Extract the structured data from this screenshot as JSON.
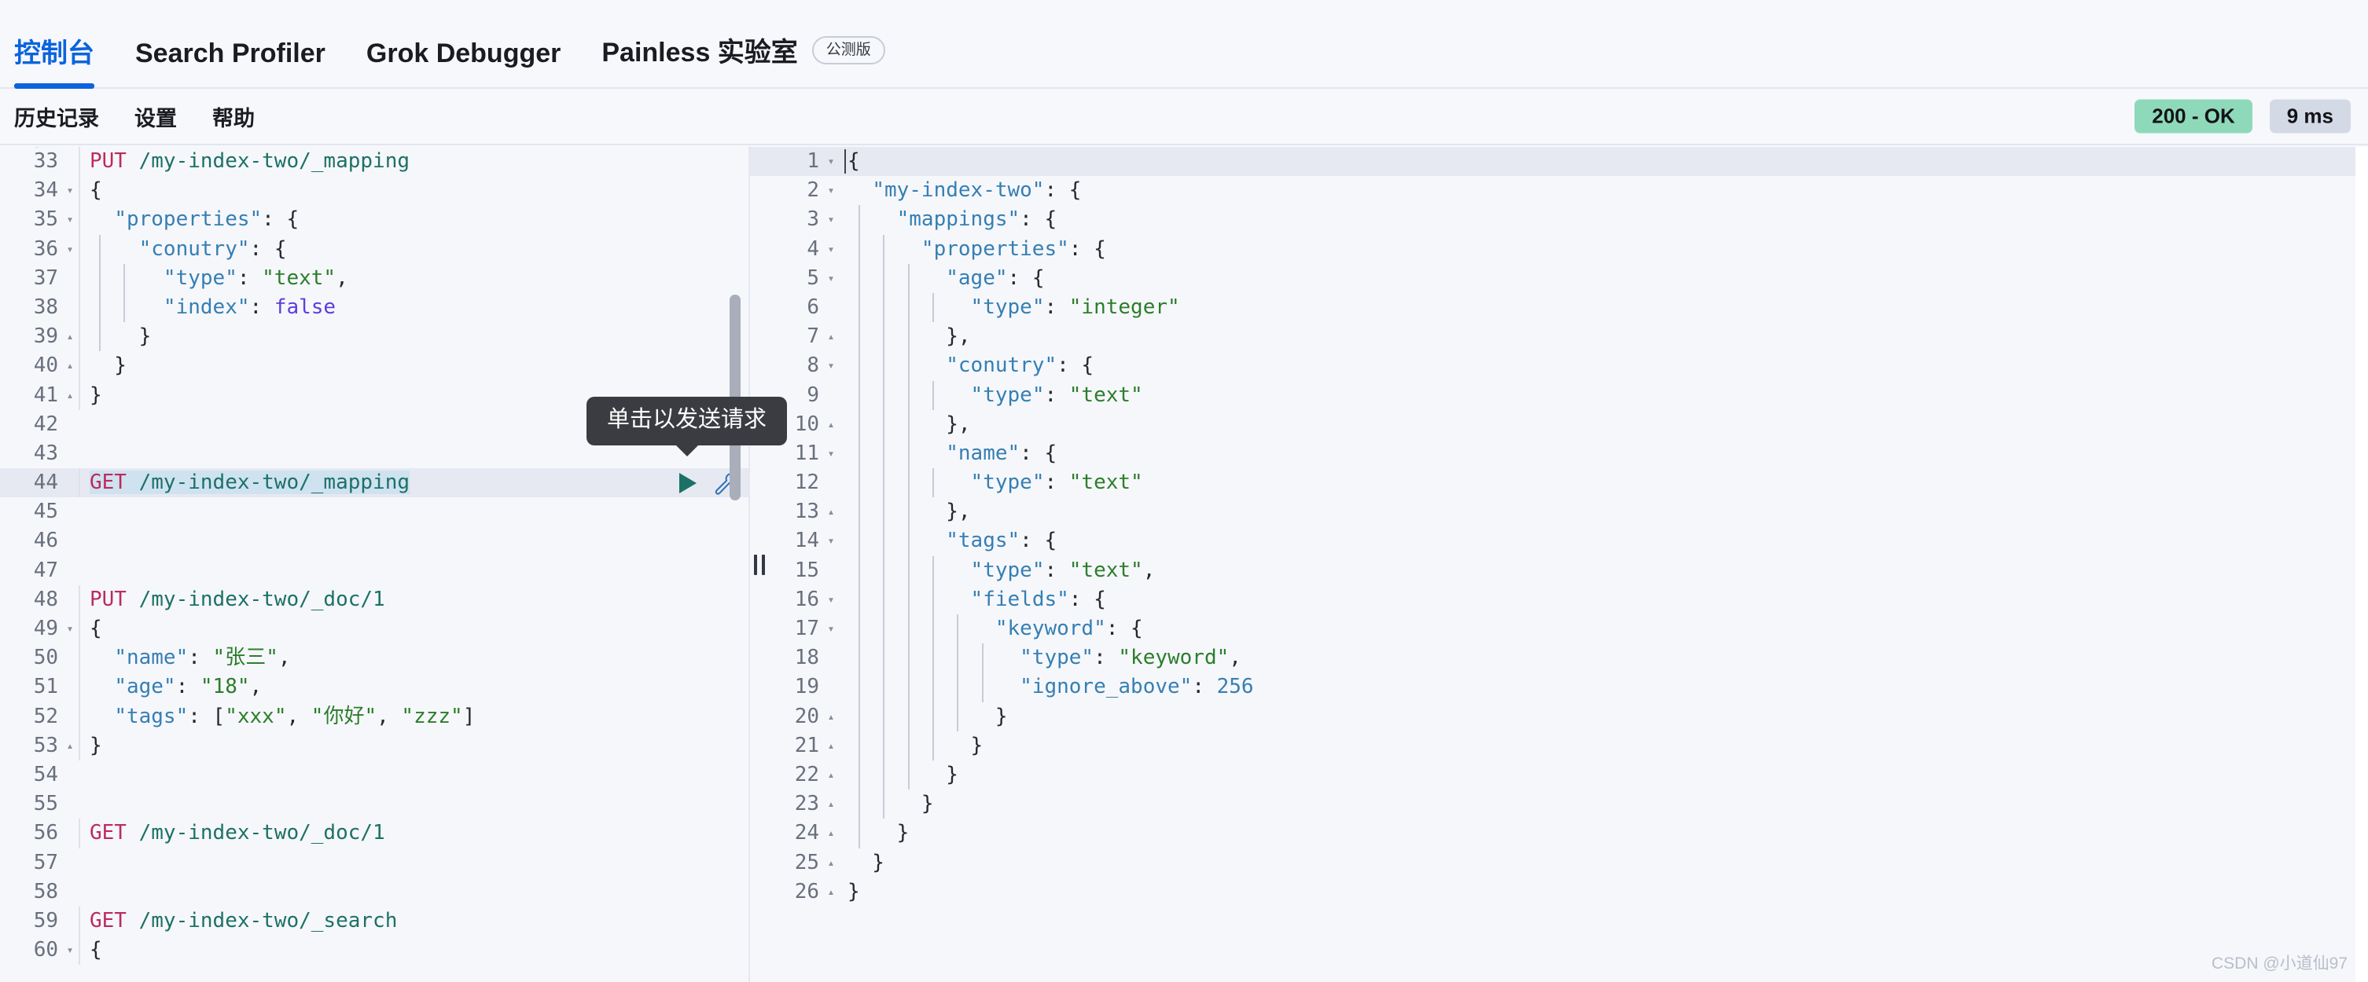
{
  "header": {
    "tabs": [
      {
        "label": "控制台",
        "active": true
      },
      {
        "label": "Search Profiler",
        "active": false
      },
      {
        "label": "Grok Debugger",
        "active": false
      },
      {
        "label": "Painless 实验室",
        "active": false,
        "badge": "公测版"
      }
    ]
  },
  "subnav": {
    "items": [
      {
        "label": "历史记录"
      },
      {
        "label": "设置"
      },
      {
        "label": "帮助"
      }
    ],
    "status_code": "200 - OK",
    "duration": "9 ms"
  },
  "tooltip": {
    "text": "单击以发送请求"
  },
  "request_editor": {
    "first_visible_line": 33,
    "highlighted_line": 44,
    "lines": [
      {
        "n": 33,
        "fold": "",
        "tokens": [
          {
            "t": "PUT",
            "c": "k-method"
          },
          {
            "t": " ",
            "c": "k-punct"
          },
          {
            "t": "/my-index-two/_mapping",
            "c": "k-url"
          }
        ]
      },
      {
        "n": 34,
        "fold": "▾",
        "tokens": [
          {
            "t": "{",
            "c": "k-punct"
          }
        ]
      },
      {
        "n": 35,
        "fold": "▾",
        "indent": 0,
        "tokens": [
          {
            "t": "  ",
            "c": "k-punct"
          },
          {
            "t": "\"properties\"",
            "c": "k-key"
          },
          {
            "t": ": {",
            "c": "k-punct"
          }
        ]
      },
      {
        "n": 36,
        "fold": "▾",
        "indent": 1,
        "tokens": [
          {
            "t": "    ",
            "c": "k-punct"
          },
          {
            "t": "\"conutry\"",
            "c": "k-key"
          },
          {
            "t": ": {",
            "c": "k-punct"
          }
        ]
      },
      {
        "n": 37,
        "fold": "",
        "indent": 2,
        "tokens": [
          {
            "t": "      ",
            "c": "k-punct"
          },
          {
            "t": "\"type\"",
            "c": "k-key"
          },
          {
            "t": ": ",
            "c": "k-punct"
          },
          {
            "t": "\"text\"",
            "c": "k-string"
          },
          {
            "t": ",",
            "c": "k-punct"
          }
        ]
      },
      {
        "n": 38,
        "fold": "",
        "indent": 2,
        "tokens": [
          {
            "t": "      ",
            "c": "k-punct"
          },
          {
            "t": "\"index\"",
            "c": "k-key"
          },
          {
            "t": ": ",
            "c": "k-punct"
          },
          {
            "t": "false",
            "c": "k-bool"
          }
        ]
      },
      {
        "n": 39,
        "fold": "▴",
        "indent": 1,
        "tokens": [
          {
            "t": "    }",
            "c": "k-punct"
          }
        ]
      },
      {
        "n": 40,
        "fold": "▴",
        "indent": 0,
        "tokens": [
          {
            "t": "  }",
            "c": "k-punct"
          }
        ]
      },
      {
        "n": 41,
        "fold": "▴",
        "tokens": [
          {
            "t": "}",
            "c": "k-punct"
          }
        ]
      },
      {
        "n": 42,
        "fold": "",
        "tokens": []
      },
      {
        "n": 43,
        "fold": "",
        "tokens": []
      },
      {
        "n": 44,
        "fold": "",
        "selected": true,
        "tokens": [
          {
            "t": "GET",
            "c": "k-method"
          },
          {
            "t": " ",
            "c": "k-punct"
          },
          {
            "t": "/my-index-two/_mapping",
            "c": "k-url"
          }
        ]
      },
      {
        "n": 45,
        "fold": "",
        "tokens": []
      },
      {
        "n": 46,
        "fold": "",
        "tokens": []
      },
      {
        "n": 47,
        "fold": "",
        "tokens": []
      },
      {
        "n": 48,
        "fold": "",
        "tokens": [
          {
            "t": "PUT",
            "c": "k-method"
          },
          {
            "t": " ",
            "c": "k-punct"
          },
          {
            "t": "/my-index-two/_doc/1",
            "c": "k-url"
          }
        ]
      },
      {
        "n": 49,
        "fold": "▾",
        "tokens": [
          {
            "t": "{",
            "c": "k-punct"
          }
        ]
      },
      {
        "n": 50,
        "fold": "",
        "tokens": [
          {
            "t": "  ",
            "c": "k-punct"
          },
          {
            "t": "\"name\"",
            "c": "k-key"
          },
          {
            "t": ": ",
            "c": "k-punct"
          },
          {
            "t": "\"张三\"",
            "c": "k-string"
          },
          {
            "t": ",",
            "c": "k-punct"
          }
        ]
      },
      {
        "n": 51,
        "fold": "",
        "tokens": [
          {
            "t": "  ",
            "c": "k-punct"
          },
          {
            "t": "\"age\"",
            "c": "k-key"
          },
          {
            "t": ": ",
            "c": "k-punct"
          },
          {
            "t": "\"18\"",
            "c": "k-string"
          },
          {
            "t": ",",
            "c": "k-punct"
          }
        ]
      },
      {
        "n": 52,
        "fold": "",
        "tokens": [
          {
            "t": "  ",
            "c": "k-punct"
          },
          {
            "t": "\"tags\"",
            "c": "k-key"
          },
          {
            "t": ": [",
            "c": "k-punct"
          },
          {
            "t": "\"xxx\"",
            "c": "k-string"
          },
          {
            "t": ", ",
            "c": "k-punct"
          },
          {
            "t": "\"你好\"",
            "c": "k-string"
          },
          {
            "t": ", ",
            "c": "k-punct"
          },
          {
            "t": "\"zzz\"",
            "c": "k-string"
          },
          {
            "t": "]",
            "c": "k-punct"
          }
        ]
      },
      {
        "n": 53,
        "fold": "▴",
        "tokens": [
          {
            "t": "}",
            "c": "k-punct"
          }
        ]
      },
      {
        "n": 54,
        "fold": "",
        "tokens": []
      },
      {
        "n": 55,
        "fold": "",
        "tokens": []
      },
      {
        "n": 56,
        "fold": "",
        "tokens": [
          {
            "t": "GET",
            "c": "k-method"
          },
          {
            "t": " ",
            "c": "k-punct"
          },
          {
            "t": "/my-index-two/_doc/1",
            "c": "k-url"
          }
        ]
      },
      {
        "n": 57,
        "fold": "",
        "tokens": []
      },
      {
        "n": 58,
        "fold": "",
        "tokens": []
      },
      {
        "n": 59,
        "fold": "",
        "tokens": [
          {
            "t": "GET",
            "c": "k-method"
          },
          {
            "t": " ",
            "c": "k-punct"
          },
          {
            "t": "/my-index-two/_search",
            "c": "k-url"
          }
        ]
      },
      {
        "n": 60,
        "fold": "▾",
        "tokens": [
          {
            "t": "{",
            "c": "k-punct"
          }
        ]
      }
    ]
  },
  "response_viewer": {
    "lines": [
      {
        "n": 1,
        "fold": "▾",
        "indent": 0,
        "tokens": [
          {
            "t": "{",
            "c": "k-punct"
          }
        ]
      },
      {
        "n": 2,
        "fold": "▾",
        "indent": 0,
        "tokens": [
          {
            "t": "  ",
            "c": "k-punct"
          },
          {
            "t": "\"my-index-two\"",
            "c": "k-key"
          },
          {
            "t": ": {",
            "c": "k-punct"
          }
        ]
      },
      {
        "n": 3,
        "fold": "▾",
        "indent": 1,
        "tokens": [
          {
            "t": "    ",
            "c": "k-punct"
          },
          {
            "t": "\"mappings\"",
            "c": "k-key"
          },
          {
            "t": ": {",
            "c": "k-punct"
          }
        ]
      },
      {
        "n": 4,
        "fold": "▾",
        "indent": 2,
        "tokens": [
          {
            "t": "      ",
            "c": "k-punct"
          },
          {
            "t": "\"properties\"",
            "c": "k-key"
          },
          {
            "t": ": {",
            "c": "k-punct"
          }
        ]
      },
      {
        "n": 5,
        "fold": "▾",
        "indent": 3,
        "tokens": [
          {
            "t": "        ",
            "c": "k-punct"
          },
          {
            "t": "\"age\"",
            "c": "k-key"
          },
          {
            "t": ": {",
            "c": "k-punct"
          }
        ]
      },
      {
        "n": 6,
        "fold": "",
        "indent": 4,
        "tokens": [
          {
            "t": "          ",
            "c": "k-punct"
          },
          {
            "t": "\"type\"",
            "c": "k-key"
          },
          {
            "t": ": ",
            "c": "k-punct"
          },
          {
            "t": "\"integer\"",
            "c": "k-string"
          }
        ]
      },
      {
        "n": 7,
        "fold": "▴",
        "indent": 3,
        "tokens": [
          {
            "t": "        },",
            "c": "k-punct"
          }
        ]
      },
      {
        "n": 8,
        "fold": "▾",
        "indent": 3,
        "tokens": [
          {
            "t": "        ",
            "c": "k-punct"
          },
          {
            "t": "\"conutry\"",
            "c": "k-key"
          },
          {
            "t": ": {",
            "c": "k-punct"
          }
        ]
      },
      {
        "n": 9,
        "fold": "",
        "indent": 4,
        "tokens": [
          {
            "t": "          ",
            "c": "k-punct"
          },
          {
            "t": "\"type\"",
            "c": "k-key"
          },
          {
            "t": ": ",
            "c": "k-punct"
          },
          {
            "t": "\"text\"",
            "c": "k-string"
          }
        ]
      },
      {
        "n": 10,
        "fold": "▴",
        "indent": 3,
        "tokens": [
          {
            "t": "        },",
            "c": "k-punct"
          }
        ]
      },
      {
        "n": 11,
        "fold": "▾",
        "indent": 3,
        "tokens": [
          {
            "t": "        ",
            "c": "k-punct"
          },
          {
            "t": "\"name\"",
            "c": "k-key"
          },
          {
            "t": ": {",
            "c": "k-punct"
          }
        ]
      },
      {
        "n": 12,
        "fold": "",
        "indent": 4,
        "tokens": [
          {
            "t": "          ",
            "c": "k-punct"
          },
          {
            "t": "\"type\"",
            "c": "k-key"
          },
          {
            "t": ": ",
            "c": "k-punct"
          },
          {
            "t": "\"text\"",
            "c": "k-string"
          }
        ]
      },
      {
        "n": 13,
        "fold": "▴",
        "indent": 3,
        "tokens": [
          {
            "t": "        },",
            "c": "k-punct"
          }
        ]
      },
      {
        "n": 14,
        "fold": "▾",
        "indent": 3,
        "tokens": [
          {
            "t": "        ",
            "c": "k-punct"
          },
          {
            "t": "\"tags\"",
            "c": "k-key"
          },
          {
            "t": ": {",
            "c": "k-punct"
          }
        ]
      },
      {
        "n": 15,
        "fold": "",
        "indent": 4,
        "tokens": [
          {
            "t": "          ",
            "c": "k-punct"
          },
          {
            "t": "\"type\"",
            "c": "k-key"
          },
          {
            "t": ": ",
            "c": "k-punct"
          },
          {
            "t": "\"text\"",
            "c": "k-string"
          },
          {
            "t": ",",
            "c": "k-punct"
          }
        ]
      },
      {
        "n": 16,
        "fold": "▾",
        "indent": 4,
        "tokens": [
          {
            "t": "          ",
            "c": "k-punct"
          },
          {
            "t": "\"fields\"",
            "c": "k-key"
          },
          {
            "t": ": {",
            "c": "k-punct"
          }
        ]
      },
      {
        "n": 17,
        "fold": "▾",
        "indent": 5,
        "tokens": [
          {
            "t": "            ",
            "c": "k-punct"
          },
          {
            "t": "\"keyword\"",
            "c": "k-key"
          },
          {
            "t": ": {",
            "c": "k-punct"
          }
        ]
      },
      {
        "n": 18,
        "fold": "",
        "indent": 6,
        "tokens": [
          {
            "t": "              ",
            "c": "k-punct"
          },
          {
            "t": "\"type\"",
            "c": "k-key"
          },
          {
            "t": ": ",
            "c": "k-punct"
          },
          {
            "t": "\"keyword\"",
            "c": "k-string"
          },
          {
            "t": ",",
            "c": "k-punct"
          }
        ]
      },
      {
        "n": 19,
        "fold": "",
        "indent": 6,
        "tokens": [
          {
            "t": "              ",
            "c": "k-punct"
          },
          {
            "t": "\"ignore_above\"",
            "c": "k-key"
          },
          {
            "t": ": ",
            "c": "k-punct"
          },
          {
            "t": "256",
            "c": "k-num"
          }
        ]
      },
      {
        "n": 20,
        "fold": "▴",
        "indent": 5,
        "tokens": [
          {
            "t": "            }",
            "c": "k-punct"
          }
        ]
      },
      {
        "n": 21,
        "fold": "▴",
        "indent": 4,
        "tokens": [
          {
            "t": "          }",
            "c": "k-punct"
          }
        ]
      },
      {
        "n": 22,
        "fold": "▴",
        "indent": 3,
        "tokens": [
          {
            "t": "        }",
            "c": "k-punct"
          }
        ]
      },
      {
        "n": 23,
        "fold": "▴",
        "indent": 2,
        "tokens": [
          {
            "t": "      }",
            "c": "k-punct"
          }
        ]
      },
      {
        "n": 24,
        "fold": "▴",
        "indent": 1,
        "tokens": [
          {
            "t": "    }",
            "c": "k-punct"
          }
        ]
      },
      {
        "n": 25,
        "fold": "▴",
        "indent": 0,
        "tokens": [
          {
            "t": "  }",
            "c": "k-punct"
          }
        ]
      },
      {
        "n": 26,
        "fold": "▴",
        "indent": 0,
        "tokens": [
          {
            "t": "}",
            "c": "k-punct"
          }
        ]
      }
    ]
  },
  "watermark": {
    "text": "CSDN @小道仙97"
  },
  "colors": {
    "accent": "#0b64dd",
    "status_ok_bg": "#8fd9bb",
    "duration_bg": "#d3dae6",
    "method": "#bd2a5e",
    "url": "#1c7166",
    "key": "#357fb3",
    "string": "#2b7e2b",
    "boolean": "#5d3ce0",
    "selection": "#cfe2f0",
    "tooltip_bg": "#3a3c42"
  }
}
